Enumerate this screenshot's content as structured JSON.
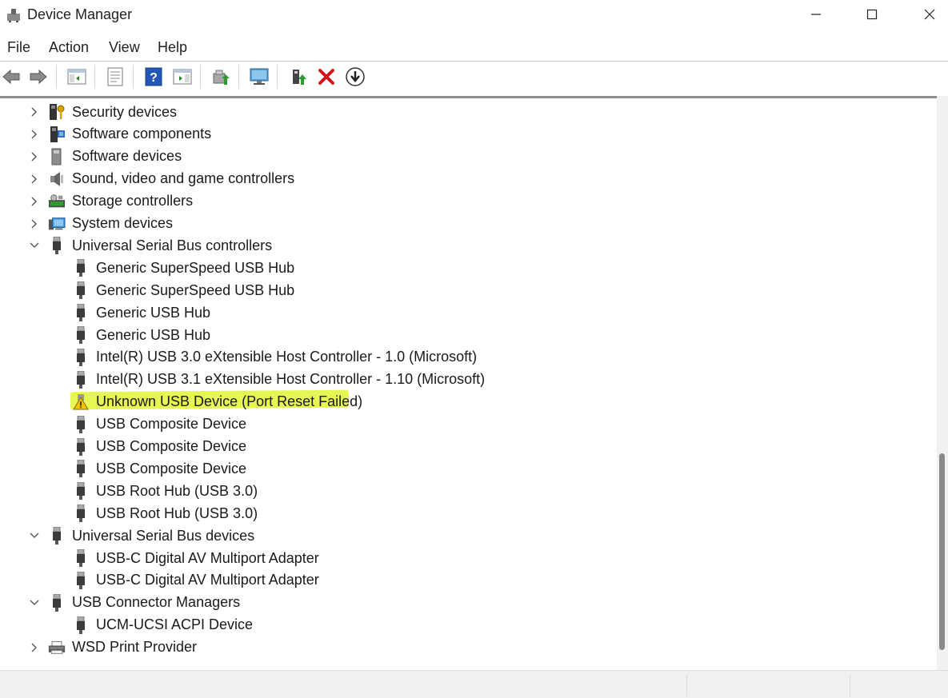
{
  "window": {
    "title": "Device Manager"
  },
  "menu": [
    "File",
    "Action",
    "View",
    "Help"
  ],
  "toolbar_icons": [
    "back-icon",
    "forward-icon",
    "show-hide-console-tree-icon",
    "properties-icon",
    "help-icon",
    "action-pane-icon",
    "update-driver-icon",
    "scan-hardware-icon",
    "enable-device-icon",
    "uninstall-device-icon",
    "download-icon"
  ],
  "tree": {
    "categories_collapsed_top": [
      {
        "label": "Security devices",
        "icon": "security-device-icon"
      },
      {
        "label": "Software components",
        "icon": "software-components-icon"
      },
      {
        "label": "Software devices",
        "icon": "software-devices-icon"
      },
      {
        "label": "Sound, video and game controllers",
        "icon": "speaker-icon"
      },
      {
        "label": "Storage controllers",
        "icon": "storage-controller-icon"
      },
      {
        "label": "System devices",
        "icon": "system-devices-icon"
      }
    ],
    "usb_controllers": {
      "label": "Universal Serial Bus controllers",
      "children": [
        "Generic SuperSpeed USB Hub",
        "Generic SuperSpeed USB Hub",
        "Generic USB Hub",
        "Generic USB Hub",
        "Intel(R) USB 3.0 eXtensible Host Controller - 1.0 (Microsoft)",
        "Intel(R) USB 3.1 eXtensible Host Controller - 1.10 (Microsoft)",
        "Unknown USB Device (Port Reset Failed)",
        "USB Composite Device",
        "USB Composite Device",
        "USB Composite Device",
        "USB Root Hub (USB 3.0)",
        "USB Root Hub (USB 3.0)"
      ]
    },
    "usb_devices": {
      "label": "Universal Serial Bus devices",
      "children": [
        "USB-C Digital AV Multiport Adapter",
        "USB-C Digital AV Multiport Adapter"
      ]
    },
    "usb_connector_managers": {
      "label": "USB Connector Managers",
      "children": [
        "UCM-UCSI ACPI Device"
      ]
    },
    "wsd": {
      "label": "WSD Print Provider"
    }
  },
  "colors": {
    "selection": "#cfe4f7",
    "marker": "#e3f542",
    "warning": "#f2c200"
  }
}
